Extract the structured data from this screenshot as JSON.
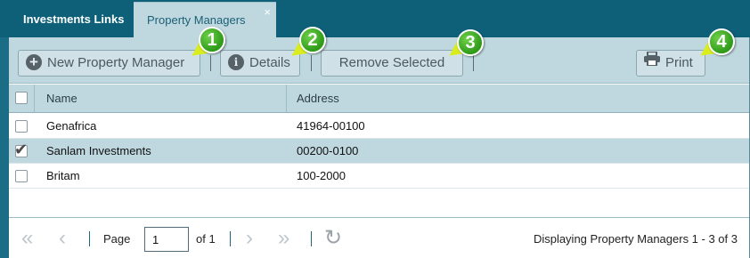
{
  "tabs": [
    {
      "label": "Investments Links"
    },
    {
      "label": "Property Managers",
      "close": "×"
    }
  ],
  "toolbar": {
    "new_label": "New Property Manager",
    "details_label": "Details",
    "remove_label": "Remove Selected",
    "print_label": "Print"
  },
  "callouts": [
    "1",
    "2",
    "3",
    "4"
  ],
  "grid": {
    "columns": [
      "Name",
      "Address"
    ],
    "rows": [
      {
        "name": "Genafrica",
        "address": "41964-00100",
        "checked": false
      },
      {
        "name": "Sanlam Investments",
        "address": "00200-0100",
        "checked": true
      },
      {
        "name": "Britam",
        "address": "100-2000",
        "checked": false
      }
    ]
  },
  "pager": {
    "page_label": "Page",
    "page_value": "1",
    "of_label": "of 1",
    "display_text": "Displaying Property Managers 1 - 3 of 3"
  },
  "icons": {
    "plus": "plus-circle-icon",
    "info": "info-circle-icon",
    "print": "printer-icon",
    "checkmark": "✔"
  },
  "colors": {
    "header_teal": "#0d6078",
    "panel_bg": "#bfd8df",
    "callout_green": "#3aad1f",
    "callout_pointer": "#d8ec1e"
  }
}
